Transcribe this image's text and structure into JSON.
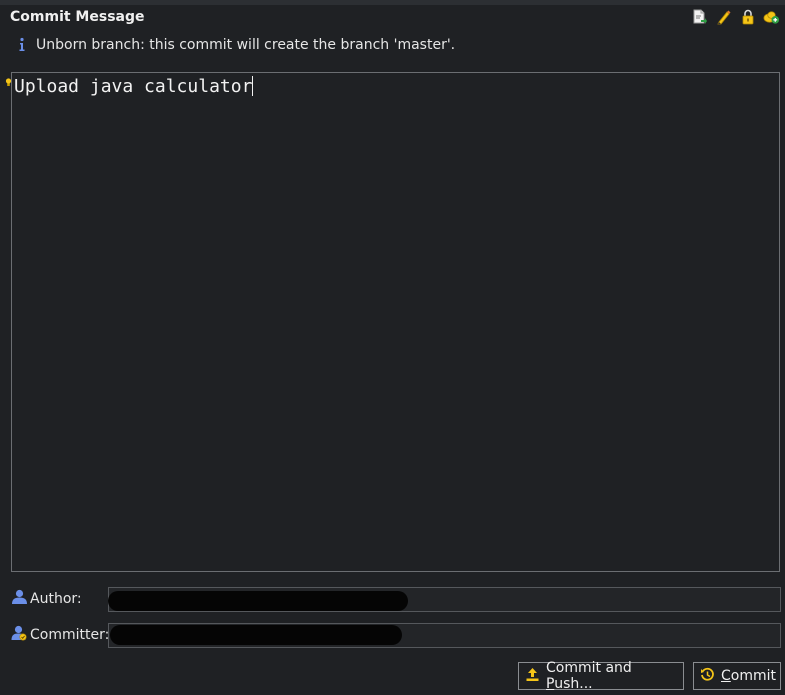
{
  "title": "Commit Message",
  "toolbar": {
    "icons": [
      "file-diff-icon",
      "edit-pencil-icon",
      "lock-icon",
      "signed-off-icon"
    ]
  },
  "info": {
    "text": "Unborn branch: this commit will create the branch 'master'."
  },
  "message": {
    "text": "Upload java calculator"
  },
  "author": {
    "label": "Author:",
    "value": ""
  },
  "committer": {
    "label": "Committer:",
    "value": ""
  },
  "buttons": {
    "commit_and_push_prefix": "Commit and ",
    "commit_and_push_mnemonic": "P",
    "commit_and_push_suffix": "ush...",
    "commit_mnemonic": "C",
    "commit_suffix": "ommit"
  },
  "colors": {
    "background": "#1f2124",
    "accent_yellow": "#f5c518",
    "user_icon_blue": "#6b8fe8",
    "info_blue": "#6b8fe8"
  }
}
